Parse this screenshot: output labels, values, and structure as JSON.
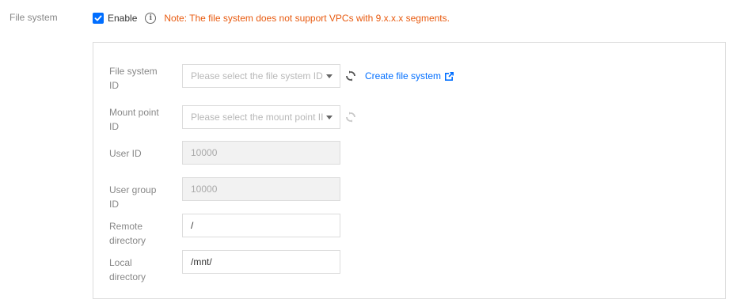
{
  "section": {
    "label": "File system"
  },
  "enable": {
    "checked": true,
    "label": "Enable",
    "note": "Note: The file system does not support VPCs with 9.x.x.x segments."
  },
  "fields": {
    "file_system_id": {
      "label_line1": "File system",
      "label_line2": "ID",
      "placeholder": "Please select the file system ID"
    },
    "mount_point_id": {
      "label_line1": "Mount point",
      "label_line2": "ID",
      "placeholder": "Please select the mount point II"
    },
    "user_id": {
      "label": "User ID",
      "value": "10000"
    },
    "user_group_id": {
      "label_line1": "User group",
      "label_line2": "ID",
      "value": "10000"
    },
    "remote_directory": {
      "label_line1": "Remote",
      "label_line2": "directory",
      "value": "/"
    },
    "local_directory": {
      "label_line1": "Local",
      "label_line2": "directory",
      "value": "/mnt/"
    }
  },
  "links": {
    "create_file_system": "Create file system"
  },
  "colors": {
    "accent": "#006eff",
    "note": "#e85a0f"
  },
  "icons": {
    "checkbox": "checkmark-icon",
    "info": "info-icon",
    "refresh": "refresh-icon",
    "external": "external-link-icon",
    "dropdown": "chevron-down-icon"
  }
}
